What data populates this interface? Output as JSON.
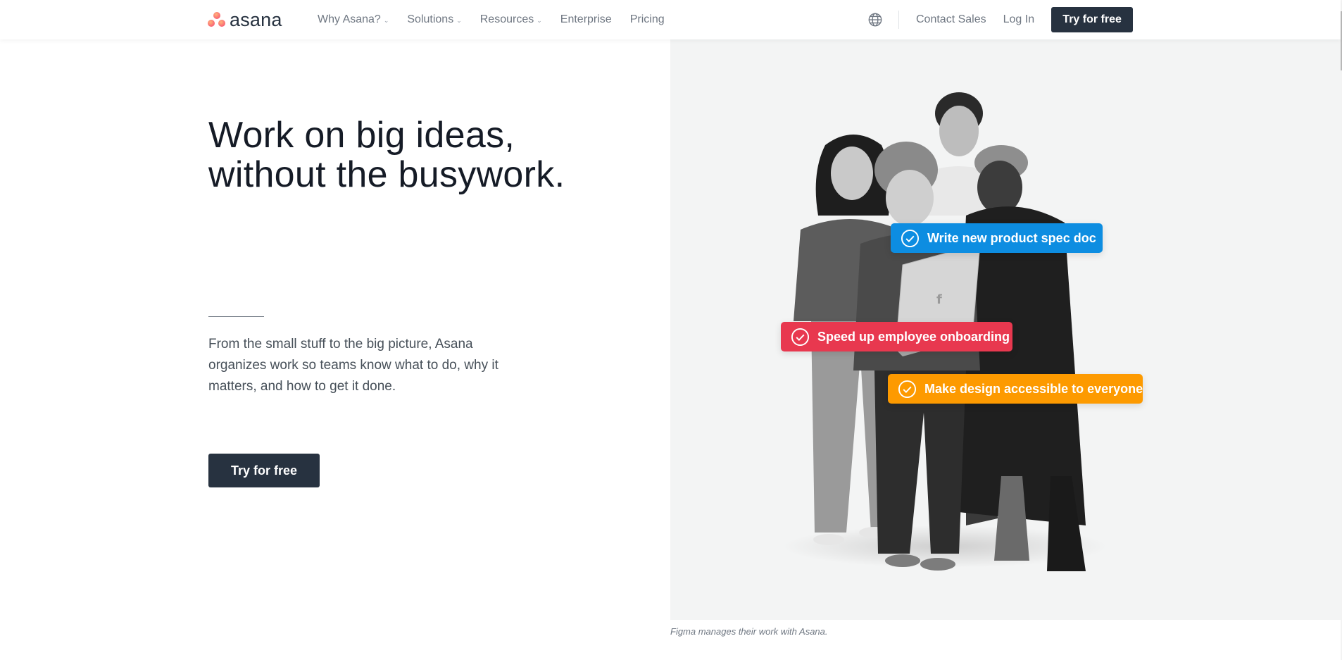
{
  "nav": {
    "logo_text": "asana",
    "links": [
      {
        "label": "Why Asana?",
        "has_dropdown": true
      },
      {
        "label": "Solutions",
        "has_dropdown": true
      },
      {
        "label": "Resources",
        "has_dropdown": true
      },
      {
        "label": "Enterprise",
        "has_dropdown": false
      },
      {
        "label": "Pricing",
        "has_dropdown": false
      }
    ],
    "language_icon": "globe-icon",
    "contact_sales": "Contact Sales",
    "log_in": "Log In",
    "cta_label": "Try for free",
    "chevron_glyph": "⌄"
  },
  "hero": {
    "title_line1": "Work on big ideas,",
    "title_line2": "without the busywork.",
    "body": "From the small stuff to the big picture, Asana organizes work so teams know what to do, why it matters, and how to get it done.",
    "cta_label": "Try for free",
    "image_alt": "Four people gathered around a laptop with a Figma logo",
    "caption": "Figma manages their work with Asana.",
    "tasks": [
      {
        "label": "Write new product spec doc",
        "color": "#0d8de1",
        "icon": "check-circle-icon"
      },
      {
        "label": "Speed up employee onboarding",
        "color": "#e8384f",
        "icon": "check-circle-icon"
      },
      {
        "label": "Make design accessible to everyone",
        "color": "#fd9a00",
        "icon": "check-circle-icon"
      }
    ]
  },
  "colors": {
    "brand_dark": "#273240",
    "text_primary": "#151b26",
    "text_secondary": "#6f7782",
    "media_bg": "#f3f4f4",
    "logo_coral": "#f95e74"
  }
}
